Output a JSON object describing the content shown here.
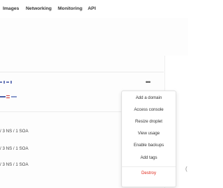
{
  "nav": {
    "items": [
      "Images",
      "Networking",
      "Monitoring",
      "API"
    ]
  },
  "table": {
    "records": [
      "/ 3 NS / 1 SOA",
      "/ 3 NS / 1 SOA",
      "/ 3 NS / 1 SOA"
    ]
  },
  "actions_menu": {
    "items": [
      "Add a domain",
      "Access console",
      "Resize droplet",
      "View usage",
      "Enable backups",
      "Add tags"
    ],
    "danger_item": "Destroy"
  },
  "more_button": {
    "label": "•••"
  },
  "right_edge_glyph": "(",
  "colors": {
    "danger": "#e0271a",
    "icon": "#6a7ab8",
    "text": "#333333"
  }
}
